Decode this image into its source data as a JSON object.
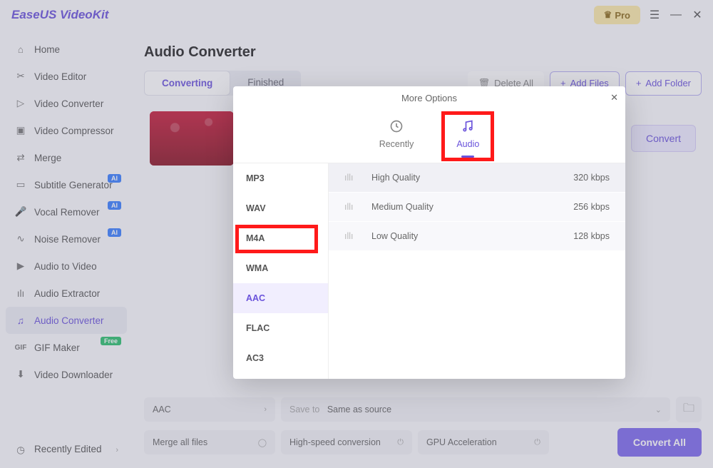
{
  "header": {
    "logo": "EaseUS VideoKit",
    "pro": "Pro"
  },
  "sidebar": {
    "items": [
      {
        "label": "Home",
        "icon": "home"
      },
      {
        "label": "Video Editor",
        "icon": "scissors"
      },
      {
        "label": "Video Converter",
        "icon": "play-circle"
      },
      {
        "label": "Video Compressor",
        "icon": "film"
      },
      {
        "label": "Merge",
        "icon": "merge"
      },
      {
        "label": "Subtitle Generator",
        "icon": "subtitle",
        "badge": "AI"
      },
      {
        "label": "Vocal Remover",
        "icon": "mic",
        "badge": "AI"
      },
      {
        "label": "Noise Remover",
        "icon": "noise",
        "badge": "AI"
      },
      {
        "label": "Audio to Video",
        "icon": "av"
      },
      {
        "label": "Audio Extractor",
        "icon": "extract"
      },
      {
        "label": "Audio Converter",
        "icon": "audio"
      },
      {
        "label": "GIF Maker",
        "icon": "gif",
        "badge": "Free"
      },
      {
        "label": "Video Downloader",
        "icon": "download"
      }
    ],
    "recently": "Recently Edited"
  },
  "page": {
    "title": "Audio Converter",
    "tabs": {
      "converting": "Converting",
      "finished": "Finished"
    },
    "toolbar": {
      "delete_all": "Delete All",
      "add_files": "Add Files",
      "add_folder": "Add Folder"
    },
    "item": {
      "convert": "Convert"
    },
    "footer": {
      "format": "AAC",
      "save_to_label": "Save to",
      "save_to_value": "Same as source",
      "merge": "Merge all files",
      "highspeed": "High-speed conversion",
      "gpu": "GPU Acceleration",
      "convert_all": "Convert All"
    }
  },
  "modal": {
    "title": "More Options",
    "tab_recently": "Recently",
    "tab_audio": "Audio",
    "formats": [
      "MP3",
      "WAV",
      "M4A",
      "WMA",
      "AAC",
      "FLAC",
      "AC3"
    ],
    "active_format": "AAC",
    "qualities": [
      {
        "name": "High Quality",
        "rate": "320 kbps"
      },
      {
        "name": "Medium Quality",
        "rate": "256 kbps"
      },
      {
        "name": "Low Quality",
        "rate": "128 kbps"
      }
    ]
  }
}
